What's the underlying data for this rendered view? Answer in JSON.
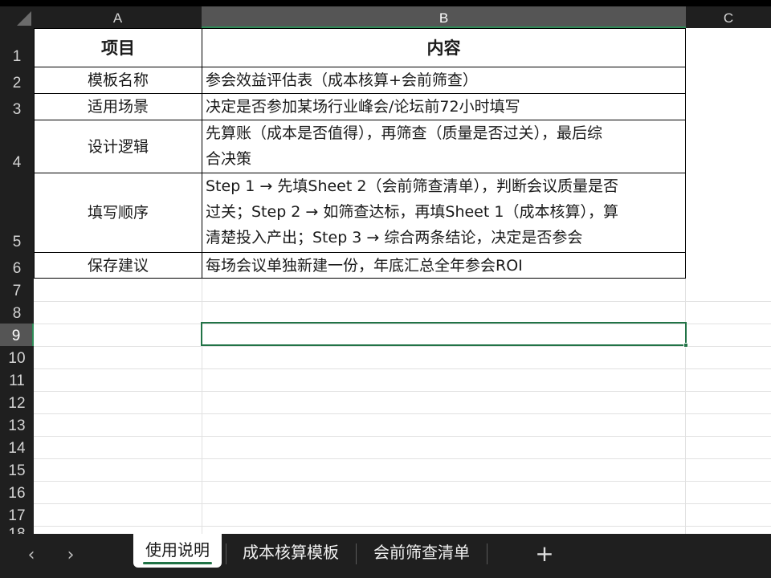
{
  "columns": [
    "A",
    "B",
    "C"
  ],
  "selected_column": "B",
  "rows": [
    "1",
    "2",
    "3",
    "4",
    "5",
    "6",
    "7",
    "8",
    "9",
    "10",
    "11",
    "12",
    "13",
    "14",
    "15",
    "16",
    "17",
    "18"
  ],
  "selected_row": "9",
  "table": {
    "header": {
      "a": "项目",
      "b": "内容"
    },
    "rows": [
      {
        "a": "模板名称",
        "b": "参会效益评估表（成本核算+会前筛查）"
      },
      {
        "a": "适用场景",
        "b": "决定是否参加某场行业峰会/论坛前72小时填写"
      },
      {
        "a": "设计逻辑",
        "b_lines": [
          "先算账（成本是否值得），再筛查（质量是否过关），最后综",
          "合决策"
        ]
      },
      {
        "a": "填写顺序",
        "b_lines": [
          "Step 1 → 先填Sheet 2（会前筛查清单），判断会议质量是否",
          "过关；Step 2 → 如筛查达标，再填Sheet 1（成本核算），算",
          "清楚投入产出；Step 3 → 综合两条结论，决定是否参会"
        ]
      },
      {
        "a": "保存建议",
        "b": "每场会议单独新建一份，年底汇总全年参会ROI"
      }
    ]
  },
  "tabs": [
    {
      "label": "使用说明",
      "active": true
    },
    {
      "label": "成本核算模板",
      "active": false
    },
    {
      "label": "会前筛查清单",
      "active": false
    }
  ],
  "icons": {
    "prev": "chevron-left-icon",
    "next": "chevron-right-icon",
    "add": "plus-icon"
  },
  "colors": {
    "accent": "#217346",
    "header_bg": "#1f1f1f",
    "selected_header_bg": "#555555"
  }
}
